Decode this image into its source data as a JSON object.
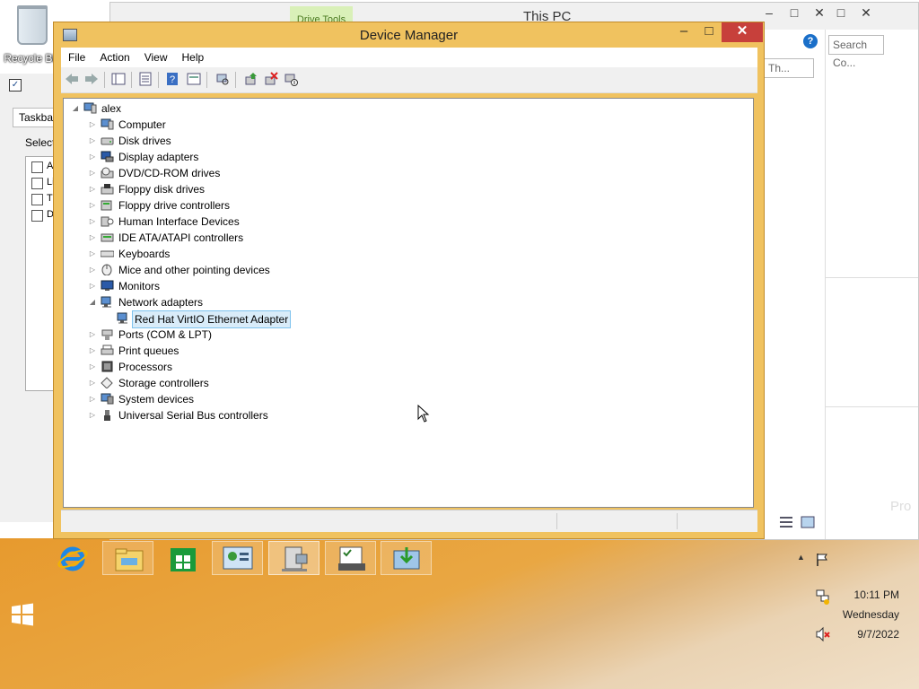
{
  "desktop": {
    "recycle_bin_label": "Recycle Bin"
  },
  "explorer": {
    "title": "This PC",
    "ribbon_tab": "Drive Tools",
    "search_placeholder": "Search Co...",
    "search_placeholder_2": "Th...",
    "watermark": "Pro"
  },
  "taskbar_props": {
    "tab_label": "Taskbar",
    "select_label": "Select",
    "items": [
      "A",
      "Li",
      "T",
      "D"
    ]
  },
  "device_manager": {
    "title": "Device Manager",
    "menu": [
      "File",
      "Action",
      "View",
      "Help"
    ],
    "root": "alex",
    "categories": [
      {
        "label": "Computer",
        "icon": "computer-icon",
        "expanded": false
      },
      {
        "label": "Disk drives",
        "icon": "disk-drive-icon",
        "expanded": false
      },
      {
        "label": "Display adapters",
        "icon": "display-adapter-icon",
        "expanded": false
      },
      {
        "label": "DVD/CD-ROM drives",
        "icon": "dvd-drive-icon",
        "expanded": false
      },
      {
        "label": "Floppy disk drives",
        "icon": "floppy-disk-icon",
        "expanded": false
      },
      {
        "label": "Floppy drive controllers",
        "icon": "floppy-controller-icon",
        "expanded": false
      },
      {
        "label": "Human Interface Devices",
        "icon": "hid-icon",
        "expanded": false
      },
      {
        "label": "IDE ATA/ATAPI controllers",
        "icon": "ide-controller-icon",
        "expanded": false
      },
      {
        "label": "Keyboards",
        "icon": "keyboard-icon",
        "expanded": false
      },
      {
        "label": "Mice and other pointing devices",
        "icon": "mouse-icon",
        "expanded": false
      },
      {
        "label": "Monitors",
        "icon": "monitor-icon",
        "expanded": false
      },
      {
        "label": "Network adapters",
        "icon": "network-adapter-icon",
        "expanded": true,
        "children": [
          {
            "label": "Red Hat VirtIO Ethernet Adapter",
            "icon": "network-adapter-icon",
            "selected": true
          }
        ]
      },
      {
        "label": "Ports (COM & LPT)",
        "icon": "port-icon",
        "expanded": false
      },
      {
        "label": "Print queues",
        "icon": "printer-icon",
        "expanded": false
      },
      {
        "label": "Processors",
        "icon": "processor-icon",
        "expanded": false
      },
      {
        "label": "Storage controllers",
        "icon": "storage-controller-icon",
        "expanded": false
      },
      {
        "label": "System devices",
        "icon": "system-device-icon",
        "expanded": false
      },
      {
        "label": "Universal Serial Bus controllers",
        "icon": "usb-icon",
        "expanded": false
      }
    ]
  },
  "clock": {
    "time": "10:11 PM",
    "day": "Wednesday",
    "date": "9/7/2022"
  },
  "colors": {
    "taskbar": "#e8a33b",
    "window_frame": "#f0c25f",
    "close_button": "#c7403b",
    "selection": "#d9ecf9"
  }
}
